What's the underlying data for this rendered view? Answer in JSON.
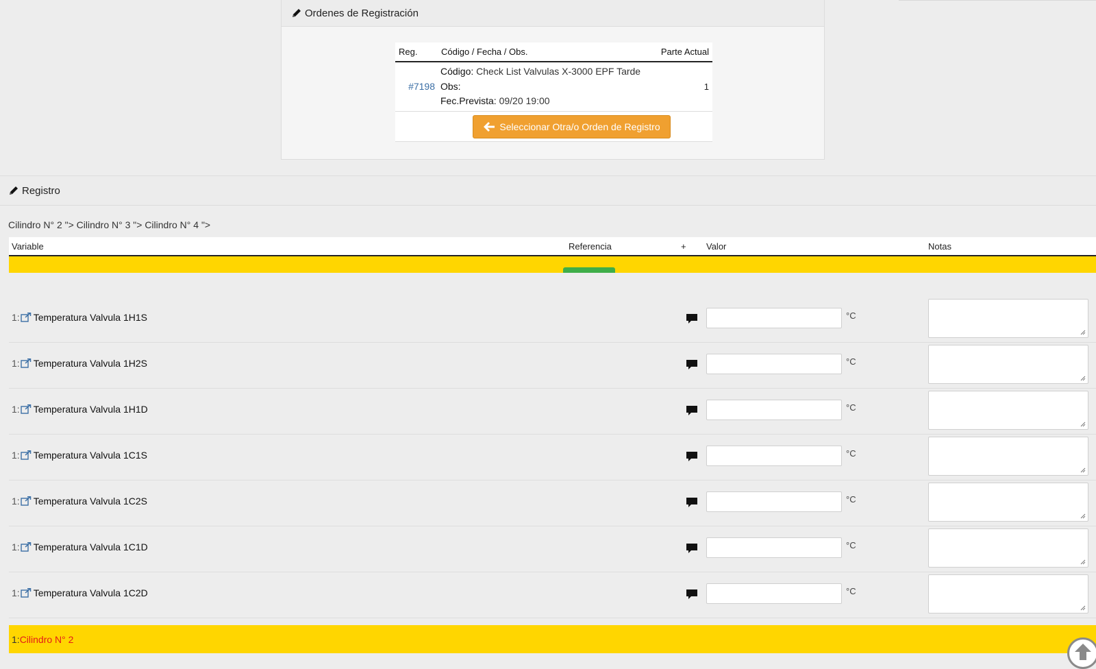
{
  "orders": {
    "title": "Ordenes de Registración",
    "headers": {
      "reg": "Reg.",
      "codigo": "Código / Fecha / Obs.",
      "parte": "Parte Actual"
    },
    "row": {
      "reg": "#7198",
      "codigo_label": "Código:",
      "codigo_value": "Check List Valvulas X-3000 EPF Tarde",
      "obs_label": "Obs:",
      "obs_value": "",
      "fecha_label": "Fec.Prevista:",
      "fecha_value": "09/20 19:00",
      "parte": "1"
    },
    "button_label": "Seleccionar Otra/o Orden de Registro"
  },
  "registro": {
    "title": "Registro",
    "breadcrumb": "Cilindro N° 2 \"> Cilindro N° 3 \"> Cilindro N° 4 \">",
    "columns": {
      "variable": "Variable",
      "referencia": "Referencia",
      "plus": "+",
      "valor": "Valor",
      "notas": "Notas"
    },
    "rows": [
      {
        "num": "1:",
        "name": "Temperatura Valvula 1H1S",
        "unit": "°C",
        "value": "",
        "notes": ""
      },
      {
        "num": "1:",
        "name": "Temperatura Valvula 1H2S",
        "unit": "°C",
        "value": "",
        "notes": ""
      },
      {
        "num": "1:",
        "name": "Temperatura Valvula 1H1D",
        "unit": "°C",
        "value": "",
        "notes": ""
      },
      {
        "num": "1:",
        "name": "Temperatura Valvula 1C1S",
        "unit": "°C",
        "value": "",
        "notes": ""
      },
      {
        "num": "1:",
        "name": "Temperatura Valvula 1C2S",
        "unit": "°C",
        "value": "",
        "notes": ""
      },
      {
        "num": "1:",
        "name": "Temperatura Valvula 1C1D",
        "unit": "°C",
        "value": "",
        "notes": ""
      },
      {
        "num": "1:",
        "name": "Temperatura Valvula 1C2D",
        "unit": "°C",
        "value": "",
        "notes": ""
      }
    ],
    "group": {
      "num": "1:",
      "name": "Cilindro N° 2"
    }
  },
  "colors": {
    "orange": "#f0a030",
    "yellow": "#ffd600",
    "green": "#3fae49",
    "red": "#e41b17",
    "link": "#3a6ea5"
  },
  "icons": [
    "pencil-icon",
    "external-link-icon",
    "comment-icon",
    "arrow-left-icon",
    "arrow-up-icon",
    "resize-grip-icon"
  ]
}
